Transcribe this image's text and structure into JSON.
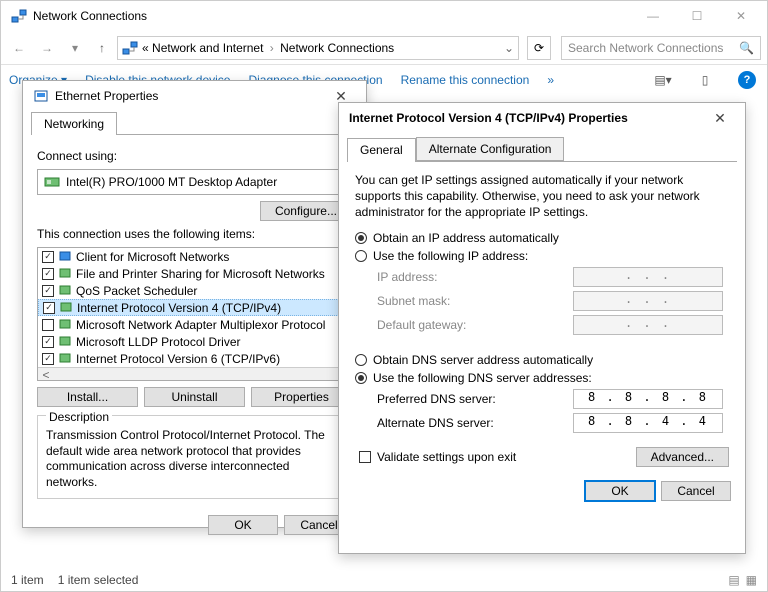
{
  "window": {
    "title": "Network Connections",
    "breadcrumb_prefix": "«",
    "breadcrumb1": "Network and Internet",
    "breadcrumb2": "Network Connections",
    "search_placeholder": "Search Network Connections"
  },
  "commands": {
    "organize": "Organize ▾",
    "disable": "Disable this network device",
    "diagnose": "Diagnose this connection",
    "rename": "Rename this connection",
    "more": "»"
  },
  "status": {
    "count": "1 item",
    "selected": "1 item selected"
  },
  "eth": {
    "title": "Ethernet Properties",
    "tab": "Networking",
    "connect_using": "Connect using:",
    "adapter": "Intel(R) PRO/1000 MT Desktop Adapter",
    "configure": "Configure...",
    "items_label": "This connection uses the following items:",
    "items": [
      {
        "checked": true,
        "label": "Client for Microsoft Networks"
      },
      {
        "checked": true,
        "label": "File and Printer Sharing for Microsoft Networks"
      },
      {
        "checked": true,
        "label": "QoS Packet Scheduler"
      },
      {
        "checked": true,
        "label": "Internet Protocol Version 4 (TCP/IPv4)",
        "selected": true
      },
      {
        "checked": false,
        "label": "Microsoft Network Adapter Multiplexor Protocol"
      },
      {
        "checked": true,
        "label": "Microsoft LLDP Protocol Driver"
      },
      {
        "checked": true,
        "label": "Internet Protocol Version 6 (TCP/IPv6)"
      }
    ],
    "install": "Install...",
    "uninstall": "Uninstall",
    "properties": "Properties",
    "desc_legend": "Description",
    "desc_text": "Transmission Control Protocol/Internet Protocol. The default wide area network protocol that provides communication across diverse interconnected networks.",
    "ok": "OK",
    "cancel": "Cancel"
  },
  "ipv4": {
    "title": "Internet Protocol Version 4 (TCP/IPv4) Properties",
    "tab_general": "General",
    "tab_alt": "Alternate Configuration",
    "desc": "You can get IP settings assigned automatically if your network supports this capability. Otherwise, you need to ask your network administrator for the appropriate IP settings.",
    "ip_auto": "Obtain an IP address automatically",
    "ip_manual": "Use the following IP address:",
    "ip_address": "IP address:",
    "subnet": "Subnet mask:",
    "gateway": "Default gateway:",
    "dns_auto": "Obtain DNS server address automatically",
    "dns_manual": "Use the following DNS server addresses:",
    "pref_dns_label": "Preferred DNS server:",
    "alt_dns_label": "Alternate DNS server:",
    "pref_dns": "8 . 8 . 8 . 8",
    "alt_dns": "8 . 8 . 4 . 4",
    "validate": "Validate settings upon exit",
    "advanced": "Advanced...",
    "ok": "OK",
    "cancel": "Cancel",
    "ip_placeholder": ".     .     ."
  }
}
